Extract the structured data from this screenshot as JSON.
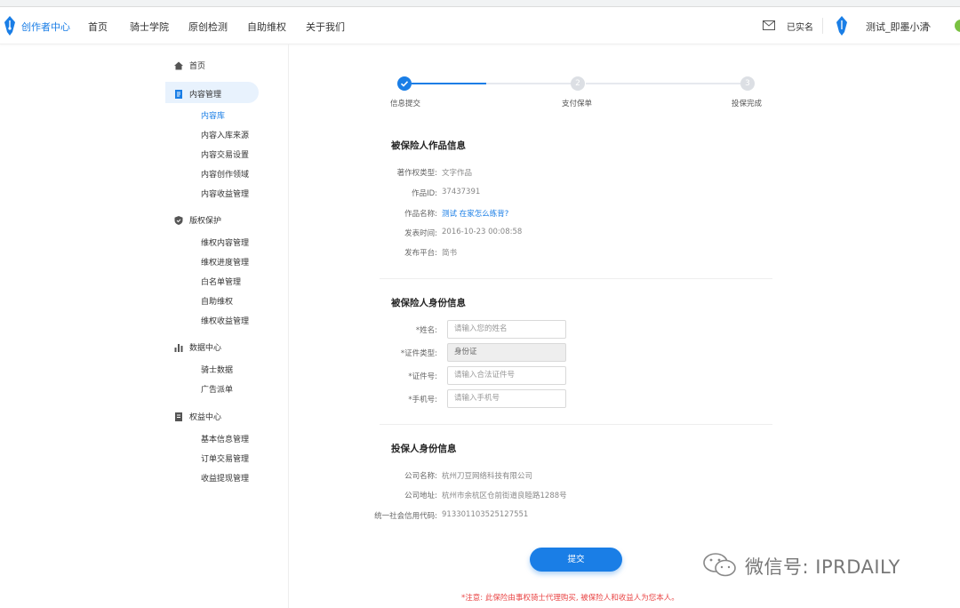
{
  "browser": {
    "url_fragment": ""
  },
  "header": {
    "brand": "创作者中心",
    "nav": [
      "首页",
      "骑士学院",
      "原创检测",
      "自助维权",
      "关于我们"
    ],
    "verified": "已实名",
    "username": "测试_即墨小清"
  },
  "sidebar": {
    "home": "首页",
    "content": {
      "label": "内容管理",
      "items": [
        "内容库",
        "内容入库来源",
        "内容交易设置",
        "内容创作领域",
        "内容收益管理"
      ]
    },
    "copyright": {
      "label": "版权保护",
      "items": [
        "维权内容管理",
        "维权进度管理",
        "白名单管理",
        "自助维权",
        "维权收益管理"
      ]
    },
    "data": {
      "label": "数据中心",
      "items": [
        "骑士数据",
        "广告派单"
      ]
    },
    "rights": {
      "label": "权益中心",
      "items": [
        "基本信息管理",
        "订单交易管理",
        "收益提现管理"
      ]
    }
  },
  "steps": [
    {
      "num": "1",
      "label": "信息提交",
      "done": true
    },
    {
      "num": "2",
      "label": "支付保单",
      "done": false
    },
    {
      "num": "3",
      "label": "投保完成",
      "done": false
    }
  ],
  "work_info": {
    "title": "被保险人作品信息",
    "rows": [
      {
        "label": "著作权类型:",
        "value": "文字作品"
      },
      {
        "label": "作品ID:",
        "value": "37437391"
      },
      {
        "label": "作品名称:",
        "value": "测试 在家怎么练背?"
      },
      {
        "label": "发表时间:",
        "value": "2016-10-23 00:08:58"
      },
      {
        "label": "发布平台:",
        "value": "简书"
      }
    ]
  },
  "identity": {
    "title": "被保险人身份信息",
    "name_label": "*姓名:",
    "name_placeholder": "请输入您的姓名",
    "idtype_label": "*证件类型:",
    "idtype_value": "身份证",
    "idnum_label": "*证件号:",
    "idnum_placeholder": "请输入合法证件号",
    "phone_label": "*手机号:",
    "phone_placeholder": "请输入手机号"
  },
  "insurer": {
    "title": "投保人身份信息",
    "rows": [
      {
        "label": "公司名称:",
        "value": "杭州刀豆网络科技有限公司"
      },
      {
        "label": "公司地址:",
        "value": "杭州市余杭区仓前街道良睦路1288号"
      },
      {
        "label": "统一社会信用代码:",
        "value": "913301103525127551"
      }
    ]
  },
  "submit_label": "提交",
  "notice": "*注意: 此保险由事权骑士代理购买, 被保险人和收益人为您本人。",
  "watermark": "微信号: IPRDAILY",
  "colors": {
    "accent": "#1a7ee6",
    "notice": "#e94545",
    "active_bg": "#e8f2fd"
  }
}
